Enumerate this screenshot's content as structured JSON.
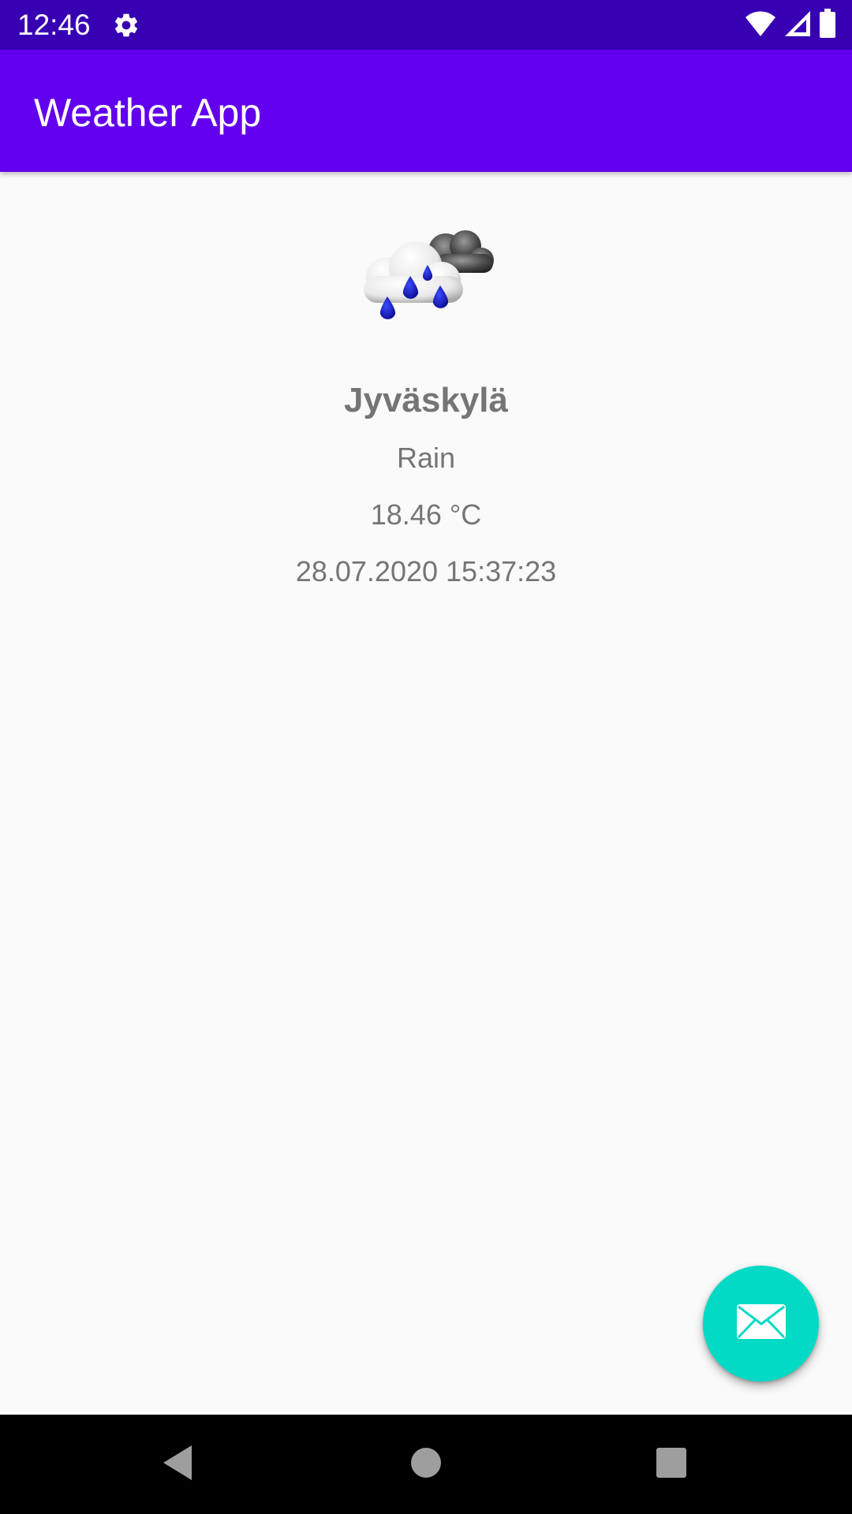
{
  "status_bar": {
    "time": "12:46",
    "icons": [
      "gear-icon",
      "wifi-icon",
      "cell-signal-icon",
      "battery-icon"
    ]
  },
  "app_bar": {
    "title": "Weather App"
  },
  "weather": {
    "icon": "rain-cloud-icon",
    "city": "Jyväskylä",
    "description": "Rain",
    "temperature": "18.46 °C",
    "timestamp": "28.07.2020 15:37:23"
  },
  "fab": {
    "icon": "envelope-icon"
  },
  "nav_bar": {
    "icons": [
      "back-icon",
      "home-icon",
      "recents-icon"
    ]
  },
  "colors": {
    "status_bar": "#3700b3",
    "app_bar": "#6200ee",
    "fab": "#03dac5",
    "background": "#fafafa",
    "text": "#757575"
  }
}
